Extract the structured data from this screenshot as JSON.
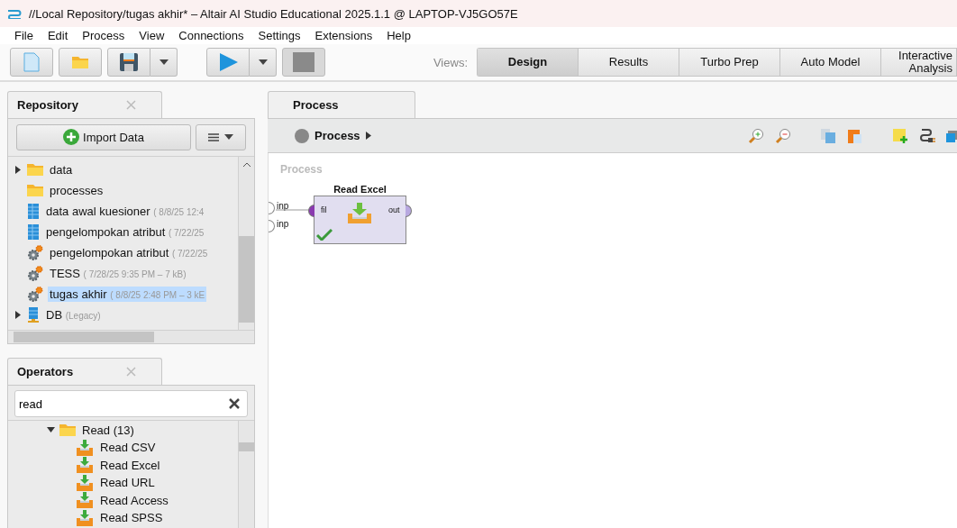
{
  "window": {
    "title": "//Local Repository/tugas akhir* – Altair AI Studio Educational 2025.1.1 @ LAPTOP-VJ5GO57E"
  },
  "menu": [
    {
      "label": "File"
    },
    {
      "label": "Edit"
    },
    {
      "label": "Process"
    },
    {
      "label": "View"
    },
    {
      "label": "Connections"
    },
    {
      "label": "Settings"
    },
    {
      "label": "Extensions"
    },
    {
      "label": "Help"
    }
  ],
  "toolbar": {
    "stop_disabled": true
  },
  "views": {
    "label": "Views:",
    "items": [
      {
        "label": "Design",
        "selected": true
      },
      {
        "label": "Results",
        "selected": false
      },
      {
        "label": "Turbo Prep",
        "selected": false
      },
      {
        "label": "Auto Model",
        "selected": false
      },
      {
        "label": "Interactive Analysis",
        "selected": false
      }
    ]
  },
  "repository": {
    "tab": "Repository",
    "import_button": "Import Data",
    "tree": [
      {
        "children": [
          {
            "label": "data",
            "kind": "folder",
            "expanded": false
          },
          {
            "label": "processes",
            "kind": "folder",
            "selected": false
          },
          {
            "label": "data awal kuesioner",
            "meta": "( 8/8/25 12:4",
            "kind": "data",
            "selected": false
          },
          {
            "label": "pengelompokan atribut",
            "meta": "( 7/22/25",
            "kind": "data",
            "selected": false
          },
          {
            "label": "pengelompokan atribut",
            "meta": "( 7/22/25",
            "kind": "process",
            "selected": false
          },
          {
            "label": "TESS",
            "meta": "( 7/28/25 9:35 PM – 7 kB)",
            "kind": "process",
            "selected": false
          },
          {
            "label": "tugas akhir",
            "meta": "( 8/8/25 2:48 PM – 3 kE",
            "kind": "process",
            "selected": true
          }
        ]
      },
      {
        "label": "DB",
        "meta": "(Legacy)",
        "kind": "db",
        "expanded": false,
        "selected": false
      }
    ]
  },
  "operators": {
    "tab": "Operators",
    "search": {
      "value": "read"
    },
    "tree": [
      {
        "label": "Read (13)",
        "kind": "folder",
        "expanded": true,
        "children": [
          {
            "label": "Read CSV",
            "kind": "operator"
          },
          {
            "label": "Read Excel",
            "kind": "operator"
          },
          {
            "label": "Read URL",
            "kind": "operator"
          },
          {
            "label": "Read Access",
            "kind": "operator"
          },
          {
            "label": "Read SPSS",
            "kind": "operator"
          }
        ]
      }
    ]
  },
  "process": {
    "tab": "Process",
    "breadcrumb": "Process",
    "canvas_label": "Process",
    "inputs": [
      "inp",
      "inp"
    ],
    "operator": {
      "name": "Read Excel",
      "in_port": "fil",
      "out_port": "out",
      "ok": true,
      "connected": true
    }
  }
}
